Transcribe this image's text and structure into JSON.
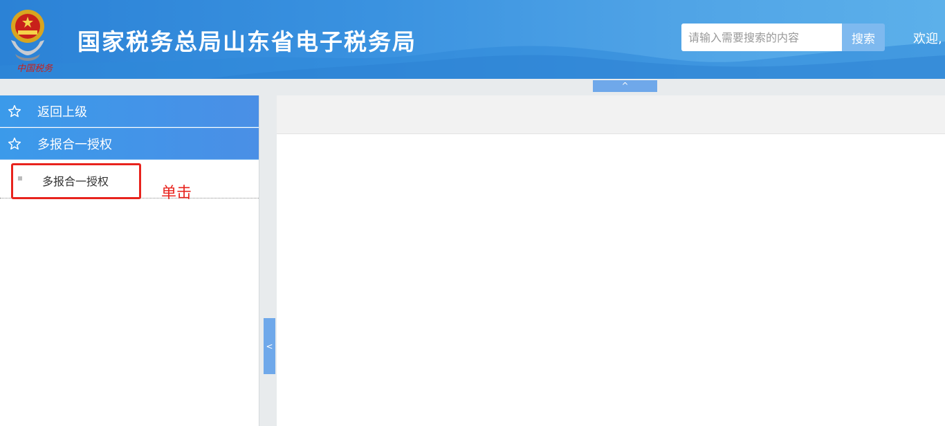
{
  "header": {
    "site_title": "国家税务总局山东省电子税务局",
    "emblem_caption": "中国税务",
    "welcome_text": "欢迎,"
  },
  "search": {
    "placeholder": "请输入需要搜索的内容",
    "button_label": "搜索"
  },
  "collapse": {
    "top_label": "^",
    "side_label": "<"
  },
  "sidebar": {
    "items": [
      {
        "label": "返回上级",
        "icon": "star-outline-icon"
      },
      {
        "label": "多报合一授权",
        "icon": "star-outline-icon"
      }
    ],
    "subitems": [
      {
        "label": "多报合一授权"
      }
    ]
  },
  "annotation": {
    "click_note": "单击"
  },
  "colors": {
    "header_blue": "#2b82d6",
    "menu_blue": "#3b9aea",
    "highlight_red": "#e8231d"
  }
}
